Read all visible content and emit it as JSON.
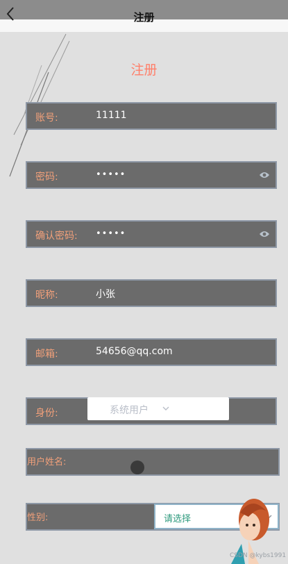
{
  "nav": {
    "title": "注册",
    "back_icon": "chevron-left-icon"
  },
  "header": {
    "title": "注册"
  },
  "form": {
    "account": {
      "label": "账号:",
      "value": "11111"
    },
    "password": {
      "label": "密码:",
      "value": "•••••",
      "toggle_icon": "eye-icon"
    },
    "confirm_password": {
      "label": "确认密码:",
      "value": "•••••",
      "toggle_icon": "eye-icon"
    },
    "nickname": {
      "label": "昵称:",
      "value": "小张"
    },
    "email": {
      "label": "邮箱:",
      "value": "54656@qq.com"
    },
    "role": {
      "label": "身份:",
      "selected": "系统用户",
      "icon": "chevron-down-icon"
    },
    "username": {
      "label": "用户姓名:"
    },
    "gender": {
      "label": "性别:",
      "placeholder": "请选择",
      "icon": "chevron-down-icon"
    }
  },
  "watermark": "CSDN @kybs1991",
  "colors": {
    "accent": "#ff7f6a",
    "label": "#f2a07a",
    "field_bg": "#6b6b6b",
    "field_border": "#8d97a5",
    "page_bg": "#e0e0e0",
    "select_text": "#2e9a7d"
  }
}
